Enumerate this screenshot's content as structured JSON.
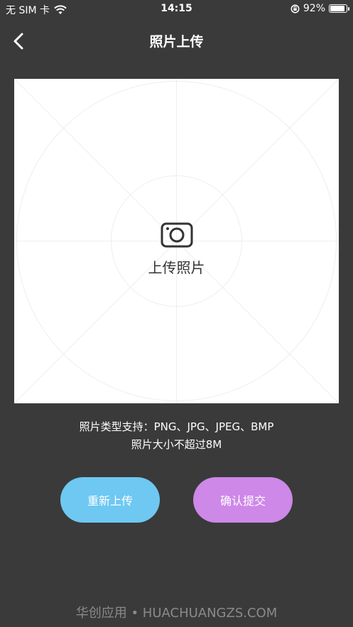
{
  "status_bar": {
    "carrier": "无 SIM 卡",
    "time": "14:15",
    "battery_percent": "92%",
    "battery_level": 0.92
  },
  "nav": {
    "title": "照片上传"
  },
  "upload": {
    "label": "上传照片"
  },
  "info": {
    "types": "照片类型支持：PNG、JPG、JPEG、BMP",
    "size": "照片大小不超过8M"
  },
  "buttons": {
    "reupload": "重新上传",
    "submit": "确认提交"
  },
  "colors": {
    "background": "#3a3a3a",
    "reupload": "#6ec8f2",
    "submit": "#cd88e8"
  },
  "watermark": "华创应用 • HUACHUANGZS.COM"
}
